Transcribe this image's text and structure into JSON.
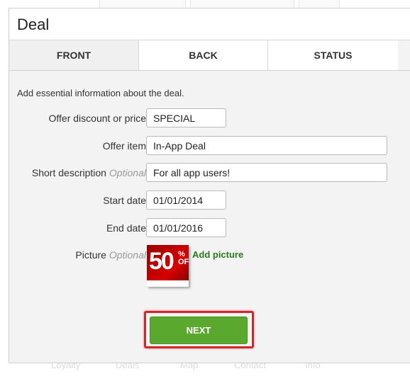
{
  "background_nav": [
    "Loyalty",
    "Deals",
    "Map",
    "Contact",
    "Info"
  ],
  "modal": {
    "title": "Deal",
    "tabs": [
      {
        "label": "FRONT",
        "active": true
      },
      {
        "label": "BACK",
        "active": false
      },
      {
        "label": "STATUS",
        "active": false
      }
    ],
    "intro": "Add essential information about the deal.",
    "optional_label": "Optional",
    "fields": {
      "offer_discount": {
        "label": "Offer discount or price",
        "value": "SPECIAL"
      },
      "offer_item": {
        "label": "Offer item",
        "value": "In-App Deal"
      },
      "short_description": {
        "label": "Short description",
        "value": "For all app users!"
      },
      "start_date": {
        "label": "Start date",
        "value": "01/01/2014"
      },
      "end_date": {
        "label": "End date",
        "value": "01/01/2016"
      },
      "picture": {
        "label": "Picture",
        "thumb_text": "50",
        "thumb_suffix": "% OFF",
        "add_label": "Add picture"
      }
    },
    "next_label": "NEXT"
  },
  "colors": {
    "accent_green": "#5aa82d",
    "highlight_red": "#d2262b",
    "link_green": "#267a1c"
  }
}
